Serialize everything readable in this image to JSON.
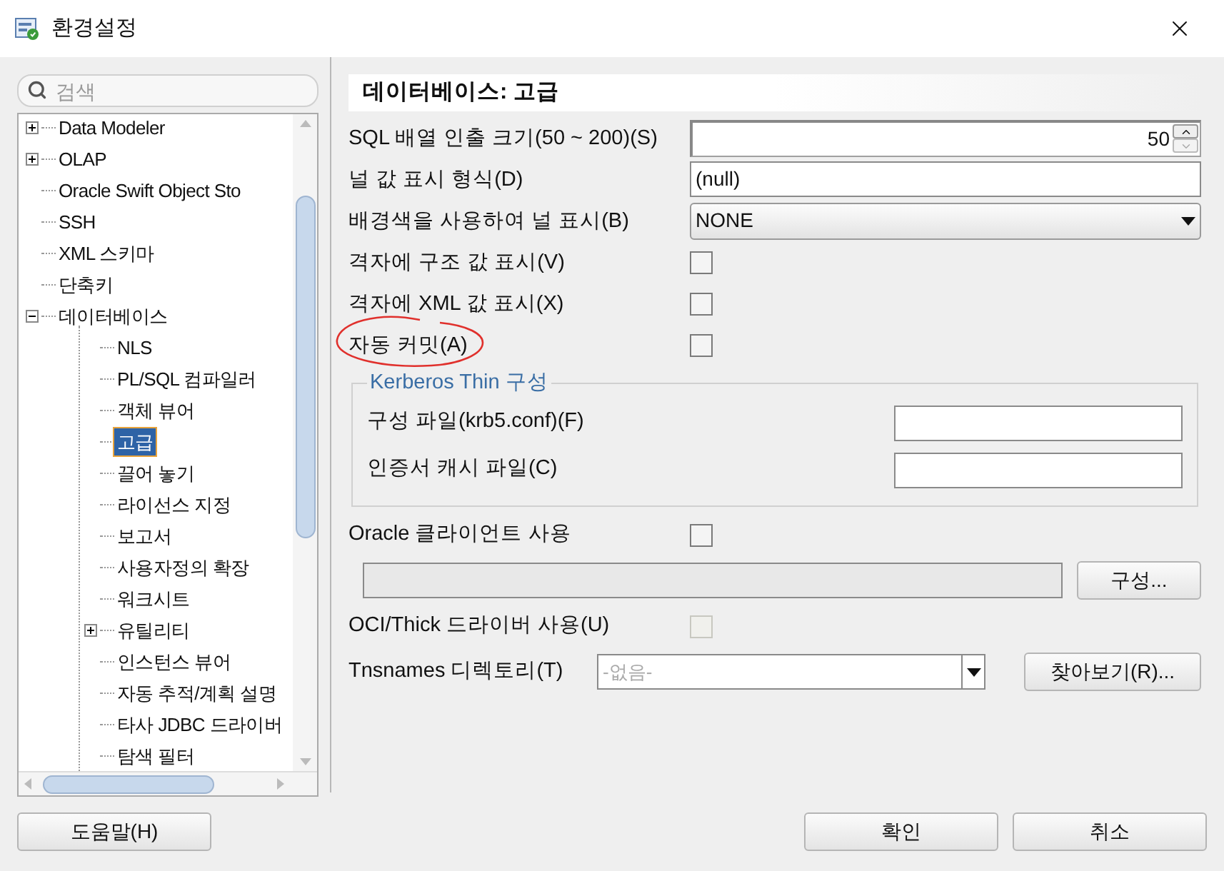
{
  "window": {
    "title": "환경설정"
  },
  "search": {
    "placeholder": "검색"
  },
  "tree": [
    {
      "label": "Data Modeler",
      "expanded": false,
      "selected": false
    },
    {
      "label": "OLAP",
      "expanded": false,
      "selected": false
    },
    {
      "label": "Oracle Swift Object Sto",
      "selected": false
    },
    {
      "label": "SSH",
      "selected": false
    },
    {
      "label": "XML 스키마",
      "selected": false
    },
    {
      "label": "단축키",
      "selected": false
    },
    {
      "label": "데이터베이스",
      "expanded": true,
      "selected": false,
      "children": [
        {
          "label": "NLS",
          "selected": false
        },
        {
          "label": "PL/SQL 컴파일러",
          "selected": false
        },
        {
          "label": "객체 뷰어",
          "selected": false
        },
        {
          "label": "고급",
          "selected": true
        },
        {
          "label": "끌어 놓기",
          "selected": false
        },
        {
          "label": "라이선스 지정",
          "selected": false
        },
        {
          "label": "보고서",
          "selected": false
        },
        {
          "label": "사용자정의 확장",
          "selected": false
        },
        {
          "label": "워크시트",
          "selected": false
        },
        {
          "label": "유틸리티",
          "expanded": false,
          "selected": false
        },
        {
          "label": "인스턴스 뷰어",
          "selected": false
        },
        {
          "label": "자동 추적/계획 설명",
          "selected": false
        },
        {
          "label": "타사 JDBC 드라이버",
          "selected": false
        },
        {
          "label": "탐색 필터",
          "selected": false
        }
      ]
    }
  ],
  "panel": {
    "heading": "데이터베이스: 고급",
    "rows": [
      {
        "kind": "spinner",
        "label": "SQL 배열 인출 크기(50 ~ 200)(S)",
        "value": "50"
      },
      {
        "kind": "text",
        "label": "널 값 표시 형식(D)",
        "value": "(null)"
      },
      {
        "kind": "select",
        "label": "배경색을 사용하여 널 표시(B)",
        "value": "NONE"
      },
      {
        "kind": "checkbox",
        "label": "격자에 구조 값 표시(V)",
        "checked": false,
        "circled": false
      },
      {
        "kind": "checkbox",
        "label": "격자에 XML 값 표시(X)",
        "checked": false,
        "circled": false
      },
      {
        "kind": "checkbox",
        "label": "자동 커밋(A)",
        "checked": false,
        "circled": true
      }
    ],
    "kerberos": {
      "title": "Kerberos Thin 구성",
      "fields": [
        {
          "label": "구성 파일(krb5.conf)(F)"
        },
        {
          "label": "인증서 캐시 파일(C)"
        }
      ]
    },
    "oracle_client": {
      "label": "Oracle 클라이언트 사용",
      "checked": false,
      "button": "구성..."
    },
    "oci": {
      "label": "OCI/Thick 드라이버 사용(U)",
      "checked": false,
      "disabled": true
    },
    "tnsnames": {
      "label": "Tnsnames 디렉토리(T)",
      "placeholder": "-없음-",
      "button": "찾아보기(R)..."
    }
  },
  "buttons": {
    "help": "도움말(H)",
    "ok": "확인",
    "cancel": "취소"
  }
}
